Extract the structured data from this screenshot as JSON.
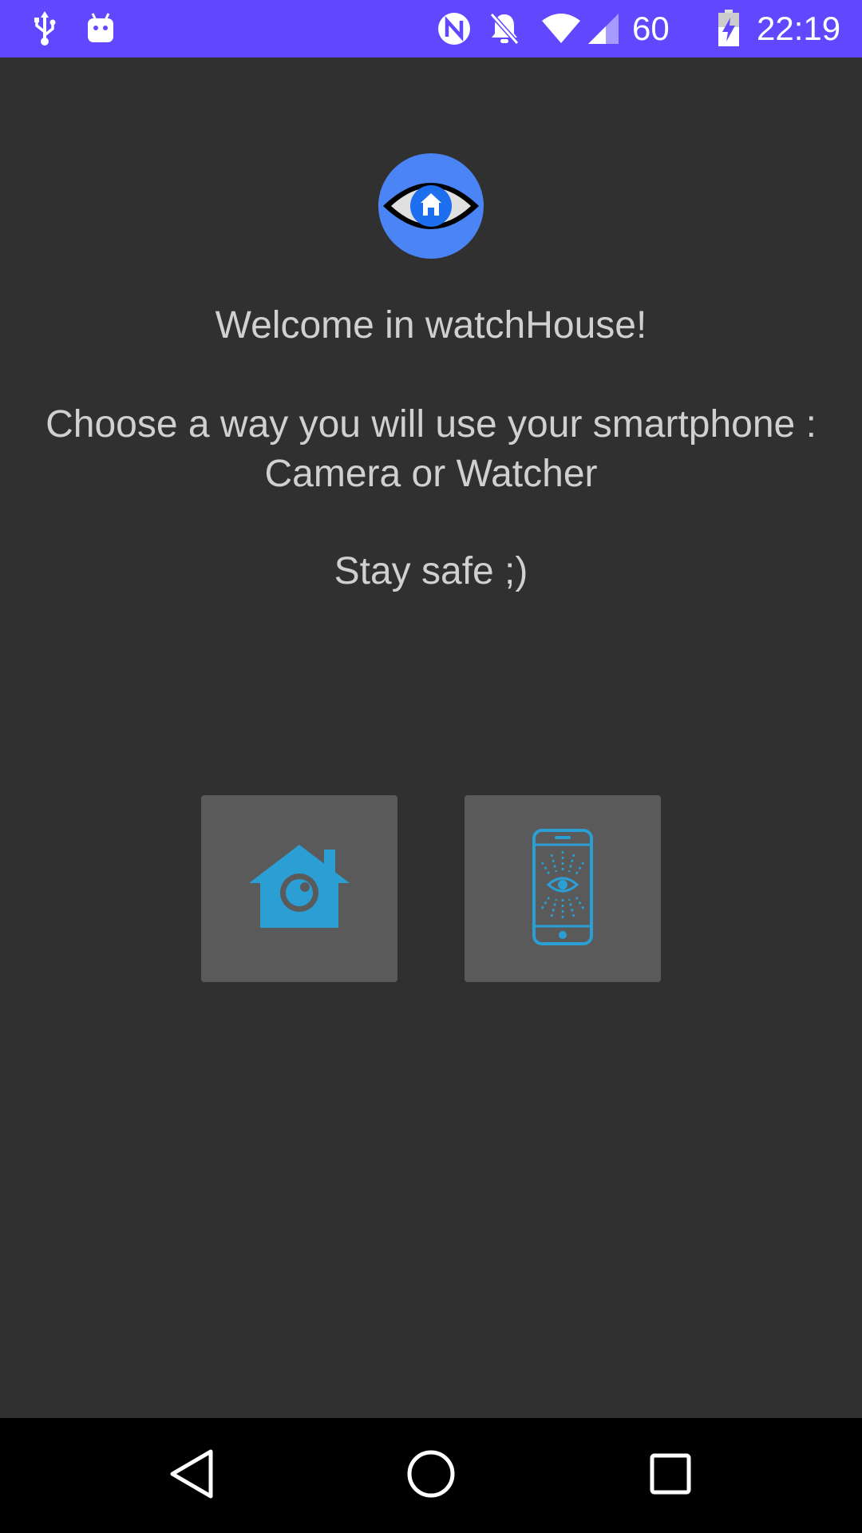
{
  "status_bar": {
    "battery_percent": "60 %",
    "time": "22:19",
    "background_color": "#6148ff",
    "left_icons": [
      "usb-icon",
      "android-debug-icon"
    ],
    "right_icons": [
      "nfc-icon",
      "notifications-off-icon",
      "wifi-icon",
      "cell-signal-icon",
      "battery-charging-icon"
    ]
  },
  "main": {
    "logo_icon": "watchhouse-eye-logo-icon",
    "welcome_text": "Welcome in watchHouse!",
    "instruction_line1": "Choose a way you will use your smartphone :",
    "instruction_line2": "Camera or Watcher",
    "farewell_text": "Stay safe ;)",
    "accent_color": "#2b9fd4",
    "buttons": [
      {
        "icon": "house-camera-icon",
        "mode": "Camera"
      },
      {
        "icon": "phone-watcher-icon",
        "mode": "Watcher"
      }
    ]
  },
  "nav_bar": {
    "back_icon": "back-triangle-icon",
    "home_icon": "home-circle-icon",
    "recents_icon": "recents-square-icon"
  }
}
